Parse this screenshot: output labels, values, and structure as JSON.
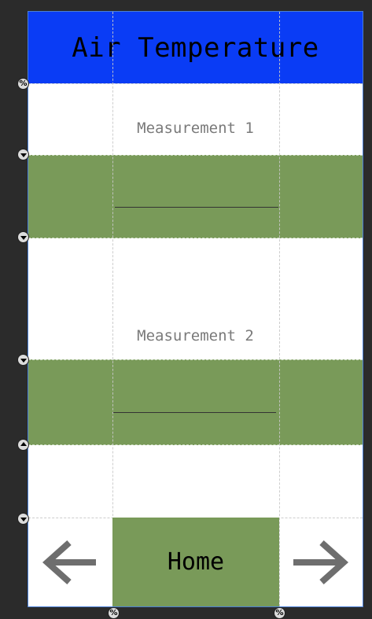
{
  "header": {
    "title": "Air Temperature",
    "color": "#0a3cf5"
  },
  "measurements": [
    {
      "label": "Measurement 1",
      "value": ""
    },
    {
      "label": "Measurement 2",
      "value": ""
    }
  ],
  "nav": {
    "home_label": "Home",
    "back_icon": "arrow-left-icon",
    "forward_icon": "arrow-right-icon"
  },
  "colors": {
    "band": "#799a59",
    "background": "#ffffff",
    "editor_background": "#2b2b2b",
    "selection_outline": "#4a7fd6"
  },
  "handles": {
    "percent_symbol": "%"
  }
}
